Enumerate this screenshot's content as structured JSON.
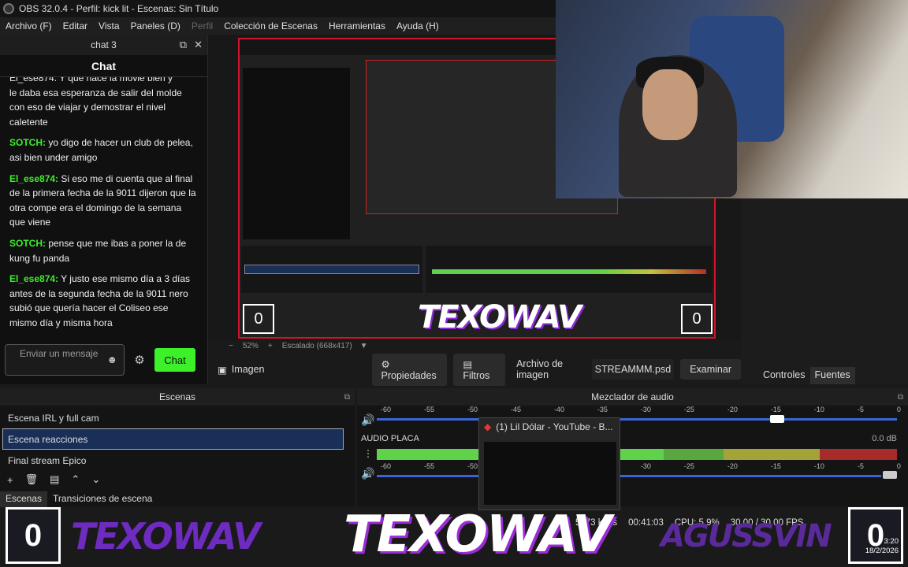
{
  "window": {
    "title": "OBS 32.0.4 - Perfil: kick lit - Escenas: Sin Título"
  },
  "menu": {
    "items": [
      "Archivo (F)",
      "Editar",
      "Vista",
      "Paneles (D)",
      "Perfil",
      "Colección de Escenas",
      "Herramientas",
      "Ayuda (H)"
    ]
  },
  "chat_dock": {
    "dock_title": "chat 3",
    "header": "Chat",
    "messages": [
      {
        "user": "",
        "text": "le daba esa esperanza de salir del molde con eso de viajar y demostrar el nivel caletente"
      },
      {
        "user": "SOTCH:",
        "text": " yo digo de hacer un club de pelea, asi bien under amigo"
      },
      {
        "user": "El_ese874:",
        "text": " Si eso me di cuenta que al final de la primera fecha de la 9011 dijeron que la otra compe era el domingo de la semana que viene"
      },
      {
        "user": "SOTCH:",
        "text": " pense que me ibas a poner la de kung fu panda"
      },
      {
        "user": "El_ese874:",
        "text": " Y justo ese mismo día a 3 días antes de la segunda fecha de la 9011 nero subió que quería hacer el Coliseo ese mismo día y misma hora"
      }
    ],
    "cutoff_line": "El_ese874: Y que hace la movie bien y",
    "input_placeholder": "Enviar un mensaje",
    "send_label": "Chat",
    "colors": {
      "send": "#3cf02a",
      "user": "#3cf02a"
    }
  },
  "preview": {
    "zoom": "52%",
    "scale_label": "Escalado (668x417)"
  },
  "source_toolbar": {
    "source_name": "Imagen",
    "properties": "Propiedades",
    "filters": "Filtros",
    "image_file_label": "Archivo de imagen",
    "image_file_value": "STREAMMM.psd",
    "browse": "Examinar"
  },
  "right_tabs": {
    "controls": "Controles",
    "sources": "Fuentes"
  },
  "scenes": {
    "title": "Escenas",
    "items": [
      "Escena IRL y full cam",
      "Escena reacciones",
      "Final stream Epico"
    ],
    "selected": "Escena reacciones",
    "tabs": [
      "Escenas",
      "Transiciones de escena"
    ]
  },
  "mixer": {
    "title": "Mezclador de audio",
    "scale": [
      "-60",
      "-55",
      "-50",
      "-45",
      "-40",
      "-35",
      "-30",
      "-25",
      "-20",
      "-15",
      "-10",
      "-5",
      "0"
    ],
    "track_name": "AUDIO PLACA",
    "track_db": "0.0 dB",
    "volume_fraction": 0.77
  },
  "popup": {
    "title": "(1) Lil Dólar - YouTube - B..."
  },
  "status": {
    "bitrate": "5773 kbps",
    "rec_time": "00:41:03",
    "cpu": "CPU: 5.9%",
    "fps": "30.00 / 30.00 FPS",
    "time": "3:20",
    "date": "18/2/2026"
  },
  "overlay": {
    "badge": "0",
    "brand_left": "TEXOWAV",
    "brand_center": "TEXOWAV",
    "brand_right": "AGUSSVIN"
  }
}
